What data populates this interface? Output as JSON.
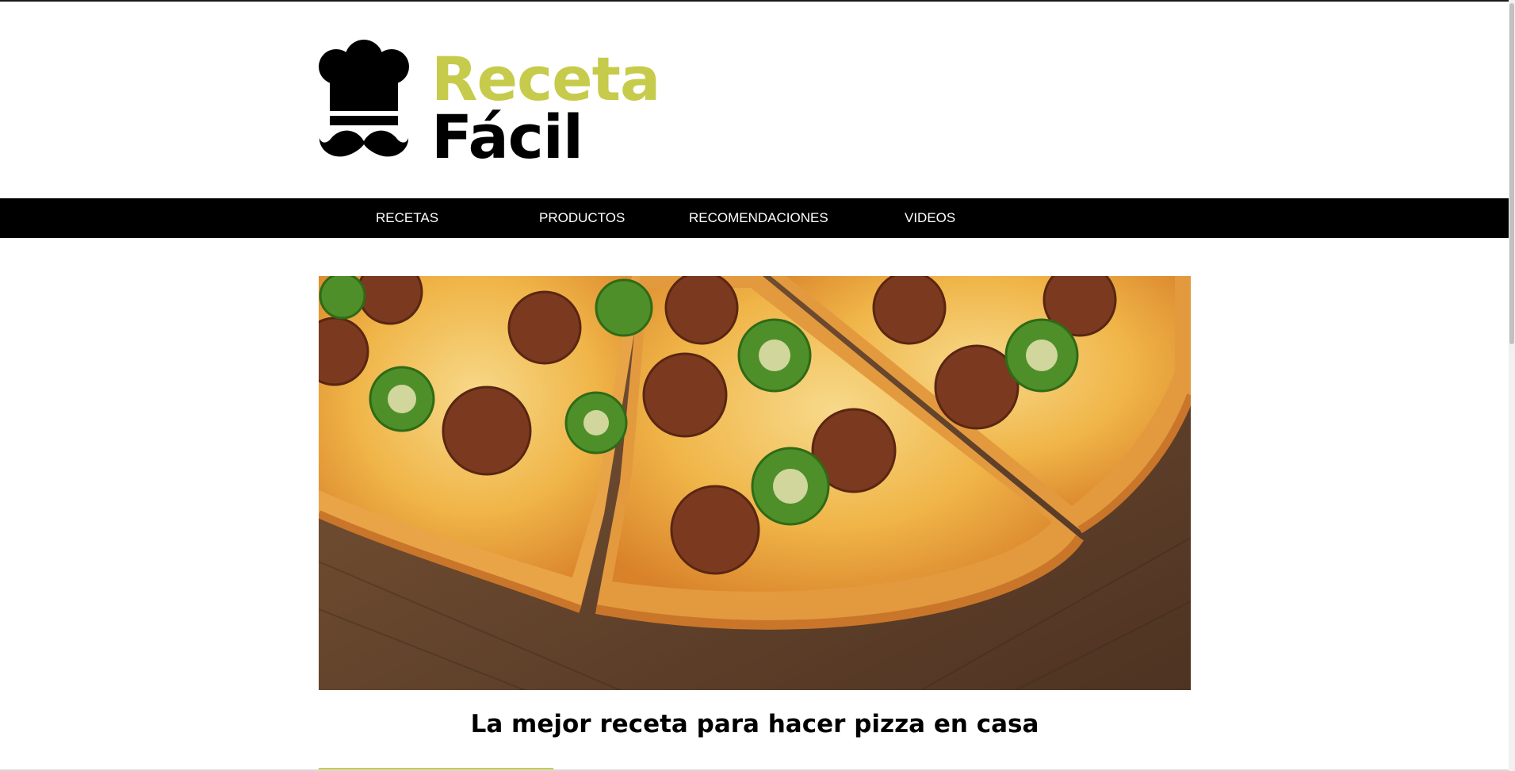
{
  "site": {
    "logo": {
      "line1": "Receta",
      "line2": "Fácil",
      "icon": "chef-hat-mustache-icon"
    },
    "nav": {
      "items": [
        {
          "label": "RECETAS"
        },
        {
          "label": "PRODUCTOS"
        },
        {
          "label": "RECOMENDACIONES"
        },
        {
          "label": "VIDEOS"
        }
      ]
    }
  },
  "main": {
    "hero_image": "pizza-photo",
    "article_title": "La mejor receta para hacer pizza en casa"
  },
  "colors": {
    "accent": "#c6cb4b",
    "nav_bg": "#000000",
    "nav_text": "#ffffff",
    "text": "#000000"
  }
}
